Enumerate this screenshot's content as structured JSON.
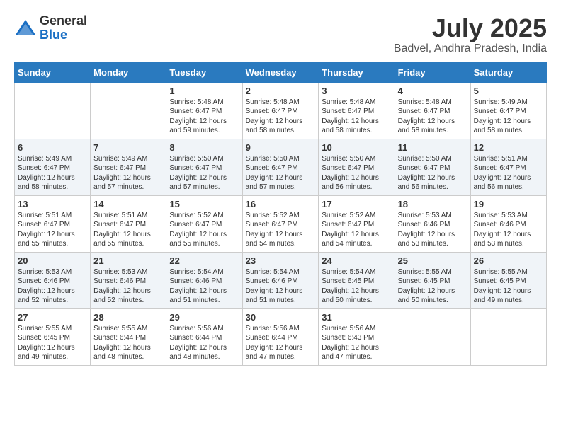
{
  "logo": {
    "general": "General",
    "blue": "Blue"
  },
  "title": "July 2025",
  "location": "Badvel, Andhra Pradesh, India",
  "weekdays": [
    "Sunday",
    "Monday",
    "Tuesday",
    "Wednesday",
    "Thursday",
    "Friday",
    "Saturday"
  ],
  "weeks": [
    [
      {
        "day": "",
        "info": ""
      },
      {
        "day": "",
        "info": ""
      },
      {
        "day": "1",
        "info": "Sunrise: 5:48 AM\nSunset: 6:47 PM\nDaylight: 12 hours and 59 minutes."
      },
      {
        "day": "2",
        "info": "Sunrise: 5:48 AM\nSunset: 6:47 PM\nDaylight: 12 hours and 58 minutes."
      },
      {
        "day": "3",
        "info": "Sunrise: 5:48 AM\nSunset: 6:47 PM\nDaylight: 12 hours and 58 minutes."
      },
      {
        "day": "4",
        "info": "Sunrise: 5:48 AM\nSunset: 6:47 PM\nDaylight: 12 hours and 58 minutes."
      },
      {
        "day": "5",
        "info": "Sunrise: 5:49 AM\nSunset: 6:47 PM\nDaylight: 12 hours and 58 minutes."
      }
    ],
    [
      {
        "day": "6",
        "info": "Sunrise: 5:49 AM\nSunset: 6:47 PM\nDaylight: 12 hours and 58 minutes."
      },
      {
        "day": "7",
        "info": "Sunrise: 5:49 AM\nSunset: 6:47 PM\nDaylight: 12 hours and 57 minutes."
      },
      {
        "day": "8",
        "info": "Sunrise: 5:50 AM\nSunset: 6:47 PM\nDaylight: 12 hours and 57 minutes."
      },
      {
        "day": "9",
        "info": "Sunrise: 5:50 AM\nSunset: 6:47 PM\nDaylight: 12 hours and 57 minutes."
      },
      {
        "day": "10",
        "info": "Sunrise: 5:50 AM\nSunset: 6:47 PM\nDaylight: 12 hours and 56 minutes."
      },
      {
        "day": "11",
        "info": "Sunrise: 5:50 AM\nSunset: 6:47 PM\nDaylight: 12 hours and 56 minutes."
      },
      {
        "day": "12",
        "info": "Sunrise: 5:51 AM\nSunset: 6:47 PM\nDaylight: 12 hours and 56 minutes."
      }
    ],
    [
      {
        "day": "13",
        "info": "Sunrise: 5:51 AM\nSunset: 6:47 PM\nDaylight: 12 hours and 55 minutes."
      },
      {
        "day": "14",
        "info": "Sunrise: 5:51 AM\nSunset: 6:47 PM\nDaylight: 12 hours and 55 minutes."
      },
      {
        "day": "15",
        "info": "Sunrise: 5:52 AM\nSunset: 6:47 PM\nDaylight: 12 hours and 55 minutes."
      },
      {
        "day": "16",
        "info": "Sunrise: 5:52 AM\nSunset: 6:47 PM\nDaylight: 12 hours and 54 minutes."
      },
      {
        "day": "17",
        "info": "Sunrise: 5:52 AM\nSunset: 6:47 PM\nDaylight: 12 hours and 54 minutes."
      },
      {
        "day": "18",
        "info": "Sunrise: 5:53 AM\nSunset: 6:46 PM\nDaylight: 12 hours and 53 minutes."
      },
      {
        "day": "19",
        "info": "Sunrise: 5:53 AM\nSunset: 6:46 PM\nDaylight: 12 hours and 53 minutes."
      }
    ],
    [
      {
        "day": "20",
        "info": "Sunrise: 5:53 AM\nSunset: 6:46 PM\nDaylight: 12 hours and 52 minutes."
      },
      {
        "day": "21",
        "info": "Sunrise: 5:53 AM\nSunset: 6:46 PM\nDaylight: 12 hours and 52 minutes."
      },
      {
        "day": "22",
        "info": "Sunrise: 5:54 AM\nSunset: 6:46 PM\nDaylight: 12 hours and 51 minutes."
      },
      {
        "day": "23",
        "info": "Sunrise: 5:54 AM\nSunset: 6:46 PM\nDaylight: 12 hours and 51 minutes."
      },
      {
        "day": "24",
        "info": "Sunrise: 5:54 AM\nSunset: 6:45 PM\nDaylight: 12 hours and 50 minutes."
      },
      {
        "day": "25",
        "info": "Sunrise: 5:55 AM\nSunset: 6:45 PM\nDaylight: 12 hours and 50 minutes."
      },
      {
        "day": "26",
        "info": "Sunrise: 5:55 AM\nSunset: 6:45 PM\nDaylight: 12 hours and 49 minutes."
      }
    ],
    [
      {
        "day": "27",
        "info": "Sunrise: 5:55 AM\nSunset: 6:45 PM\nDaylight: 12 hours and 49 minutes."
      },
      {
        "day": "28",
        "info": "Sunrise: 5:55 AM\nSunset: 6:44 PM\nDaylight: 12 hours and 48 minutes."
      },
      {
        "day": "29",
        "info": "Sunrise: 5:56 AM\nSunset: 6:44 PM\nDaylight: 12 hours and 48 minutes."
      },
      {
        "day": "30",
        "info": "Sunrise: 5:56 AM\nSunset: 6:44 PM\nDaylight: 12 hours and 47 minutes."
      },
      {
        "day": "31",
        "info": "Sunrise: 5:56 AM\nSunset: 6:43 PM\nDaylight: 12 hours and 47 minutes."
      },
      {
        "day": "",
        "info": ""
      },
      {
        "day": "",
        "info": ""
      }
    ]
  ]
}
